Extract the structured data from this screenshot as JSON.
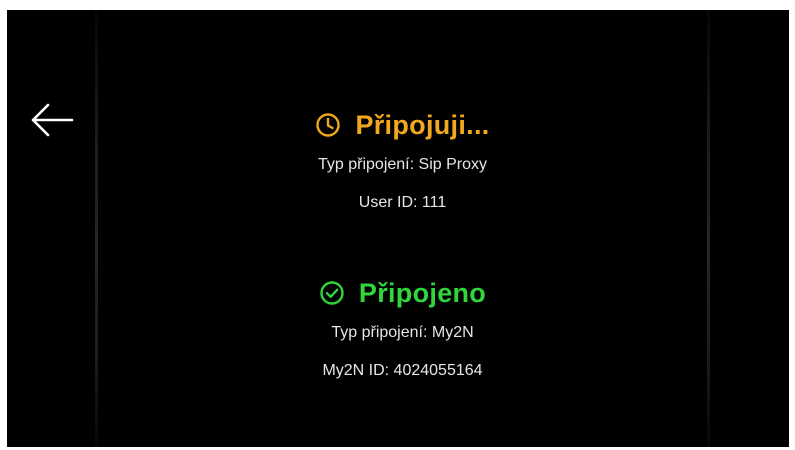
{
  "colors": {
    "background": "#000000",
    "connecting": "#f2a81c",
    "connected": "#2fd63c",
    "text": "#e6e6e6"
  },
  "nav": {
    "back_icon": "arrow-left-icon"
  },
  "connections": [
    {
      "status": "Připojuji...",
      "icon": "clock-icon",
      "type_line": "Typ připojení: Sip Proxy",
      "id_line": "User ID: 111"
    },
    {
      "status": "Připojeno",
      "icon": "check-circle-icon",
      "type_line": "Typ připojení: My2N",
      "id_line": "My2N ID: 4024055164"
    }
  ]
}
